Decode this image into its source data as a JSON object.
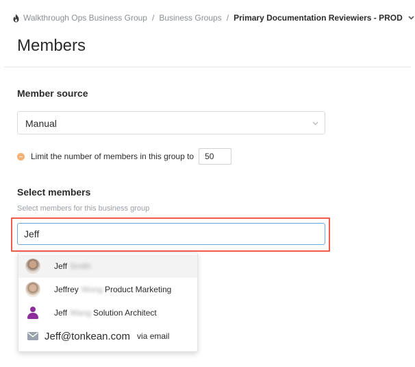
{
  "breadcrumb": {
    "items": [
      "Walkthrough Ops Business Group",
      "Business Groups"
    ],
    "separator": "/",
    "current": "Primary Documentation Reviewiers - PROD"
  },
  "page": {
    "title": "Members"
  },
  "member_source": {
    "label": "Member source",
    "selected": "Manual"
  },
  "limit": {
    "text": "Limit the number of members in this group to",
    "value": "50"
  },
  "select_members": {
    "label": "Select members",
    "helper": "Select members for this business group",
    "search_value": "Jeff"
  },
  "suggestions": [
    {
      "first": "Jeff",
      "last_blurred": "Smith",
      "title": "",
      "avatar": "photo"
    },
    {
      "first": "Jeffrey",
      "last_blurred": "Wong",
      "title": "Product Marketing",
      "avatar": "photo"
    },
    {
      "first": "Jeff",
      "last_blurred": "Wang",
      "title": "Solution Architect",
      "avatar": "person-icon"
    }
  ],
  "email_suggestion": {
    "email": "Jeff@tonkean.com",
    "suffix": "via email"
  },
  "colors": {
    "highlight": "#ef5a4b",
    "focus_border": "#6fa8dc",
    "limit_icon": "#f6b172",
    "person_icon": "#8b2e9a"
  }
}
